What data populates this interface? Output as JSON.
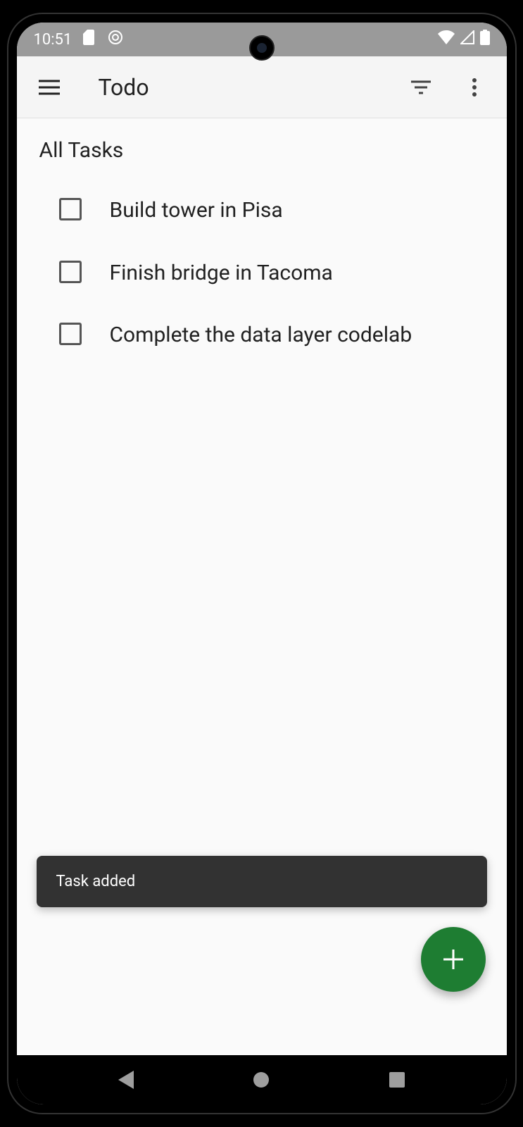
{
  "status_bar": {
    "time": "10:51"
  },
  "app_bar": {
    "title": "Todo"
  },
  "content": {
    "section_title": "All Tasks",
    "tasks": [
      {
        "label": "Build tower in Pisa",
        "checked": false
      },
      {
        "label": "Finish bridge in Tacoma",
        "checked": false
      },
      {
        "label": "Complete the data layer codelab",
        "checked": false
      }
    ]
  },
  "snackbar": {
    "message": "Task added"
  }
}
